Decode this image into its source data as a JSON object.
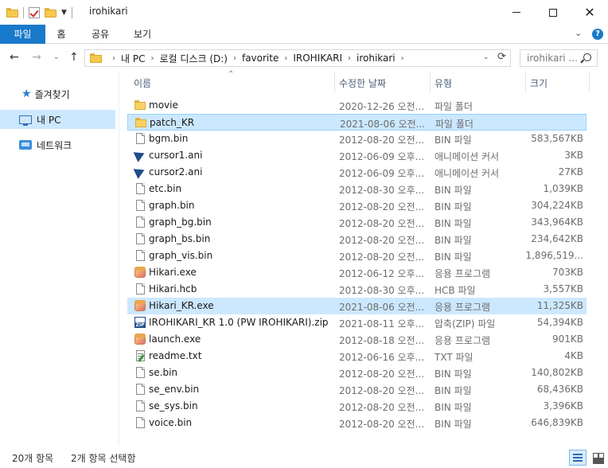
{
  "window": {
    "title": "irohikari"
  },
  "ribbon": {
    "tabs": [
      "파일",
      "홈",
      "공유",
      "보기"
    ]
  },
  "address": {
    "crumbs": [
      "내 PC",
      "로컬 디스크 (D:)",
      "favorite",
      "IROHIKARI",
      "irohikari"
    ],
    "search_placeholder": "irohikari ..."
  },
  "nav": {
    "quick": "즐겨찾기",
    "pc": "내 PC",
    "network": "네트워크"
  },
  "columns": {
    "name": "이름",
    "date": "수정한 날짜",
    "type": "유형",
    "size": "크기"
  },
  "files": [
    {
      "icon": "folder-icon",
      "name": "movie",
      "date": "2020-12-26 오전...",
      "type": "파일 폴더",
      "size": "",
      "selected": false
    },
    {
      "icon": "folder-icon",
      "name": "patch_KR",
      "date": "2021-08-06 오전...",
      "type": "파일 폴더",
      "size": "",
      "selected": true
    },
    {
      "icon": "file-icon",
      "name": "bgm.bin",
      "date": "2012-08-20 오전...",
      "type": "BIN 파일",
      "size": "583,567KB",
      "selected": false
    },
    {
      "icon": "cursor-icon",
      "name": "cursor1.ani",
      "date": "2012-06-09 오후...",
      "type": "애니메이션 커서",
      "size": "3KB",
      "selected": false
    },
    {
      "icon": "cursor-icon",
      "name": "cursor2.ani",
      "date": "2012-06-09 오후...",
      "type": "애니메이션 커서",
      "size": "27KB",
      "selected": false
    },
    {
      "icon": "file-icon",
      "name": "etc.bin",
      "date": "2012-08-30 오후...",
      "type": "BIN 파일",
      "size": "1,039KB",
      "selected": false
    },
    {
      "icon": "file-icon",
      "name": "graph.bin",
      "date": "2012-08-20 오전...",
      "type": "BIN 파일",
      "size": "304,224KB",
      "selected": false
    },
    {
      "icon": "file-icon",
      "name": "graph_bg.bin",
      "date": "2012-08-20 오전...",
      "type": "BIN 파일",
      "size": "343,964KB",
      "selected": false
    },
    {
      "icon": "file-icon",
      "name": "graph_bs.bin",
      "date": "2012-08-20 오전...",
      "type": "BIN 파일",
      "size": "234,642KB",
      "selected": false
    },
    {
      "icon": "file-icon",
      "name": "graph_vis.bin",
      "date": "2012-08-20 오전...",
      "type": "BIN 파일",
      "size": "1,896,519...",
      "selected": false
    },
    {
      "icon": "app-icon",
      "name": "Hikari.exe",
      "date": "2012-06-12 오후...",
      "type": "응용 프로그램",
      "size": "703KB",
      "selected": false
    },
    {
      "icon": "file-icon",
      "name": "Hikari.hcb",
      "date": "2012-08-30 오후...",
      "type": "HCB 파일",
      "size": "3,557KB",
      "selected": false
    },
    {
      "icon": "app-icon",
      "name": "Hikari_KR.exe",
      "date": "2021-08-06 오전...",
      "type": "응용 프로그램",
      "size": "11,325KB",
      "selected": true
    },
    {
      "icon": "zip-icon",
      "name": "IROHIKARI_KR 1.0 (PW IROHIKARI).zip",
      "date": "2021-08-11 오후...",
      "type": "압축(ZIP) 파일",
      "size": "54,394KB",
      "selected": false
    },
    {
      "icon": "app-icon",
      "name": "launch.exe",
      "date": "2012-08-18 오전...",
      "type": "응용 프로그램",
      "size": "901KB",
      "selected": false
    },
    {
      "icon": "text-file-icon",
      "name": "readme.txt",
      "date": "2012-06-16 오후...",
      "type": "TXT 파일",
      "size": "4KB",
      "selected": false
    },
    {
      "icon": "file-icon",
      "name": "se.bin",
      "date": "2012-08-20 오전...",
      "type": "BIN 파일",
      "size": "140,802KB",
      "selected": false
    },
    {
      "icon": "file-icon",
      "name": "se_env.bin",
      "date": "2012-08-20 오전...",
      "type": "BIN 파일",
      "size": "68,436KB",
      "selected": false
    },
    {
      "icon": "file-icon",
      "name": "se_sys.bin",
      "date": "2012-08-20 오전...",
      "type": "BIN 파일",
      "size": "3,396KB",
      "selected": false
    },
    {
      "icon": "file-icon",
      "name": "voice.bin",
      "date": "2012-08-20 오전...",
      "type": "BIN 파일",
      "size": "646,839KB",
      "selected": false
    }
  ],
  "status": {
    "count": "20개 항목",
    "selection": "2개 항목 선택함"
  },
  "colors": {
    "accent": "#1979ca",
    "selection": "#cce8ff",
    "selection_border": "#99d1ff"
  }
}
